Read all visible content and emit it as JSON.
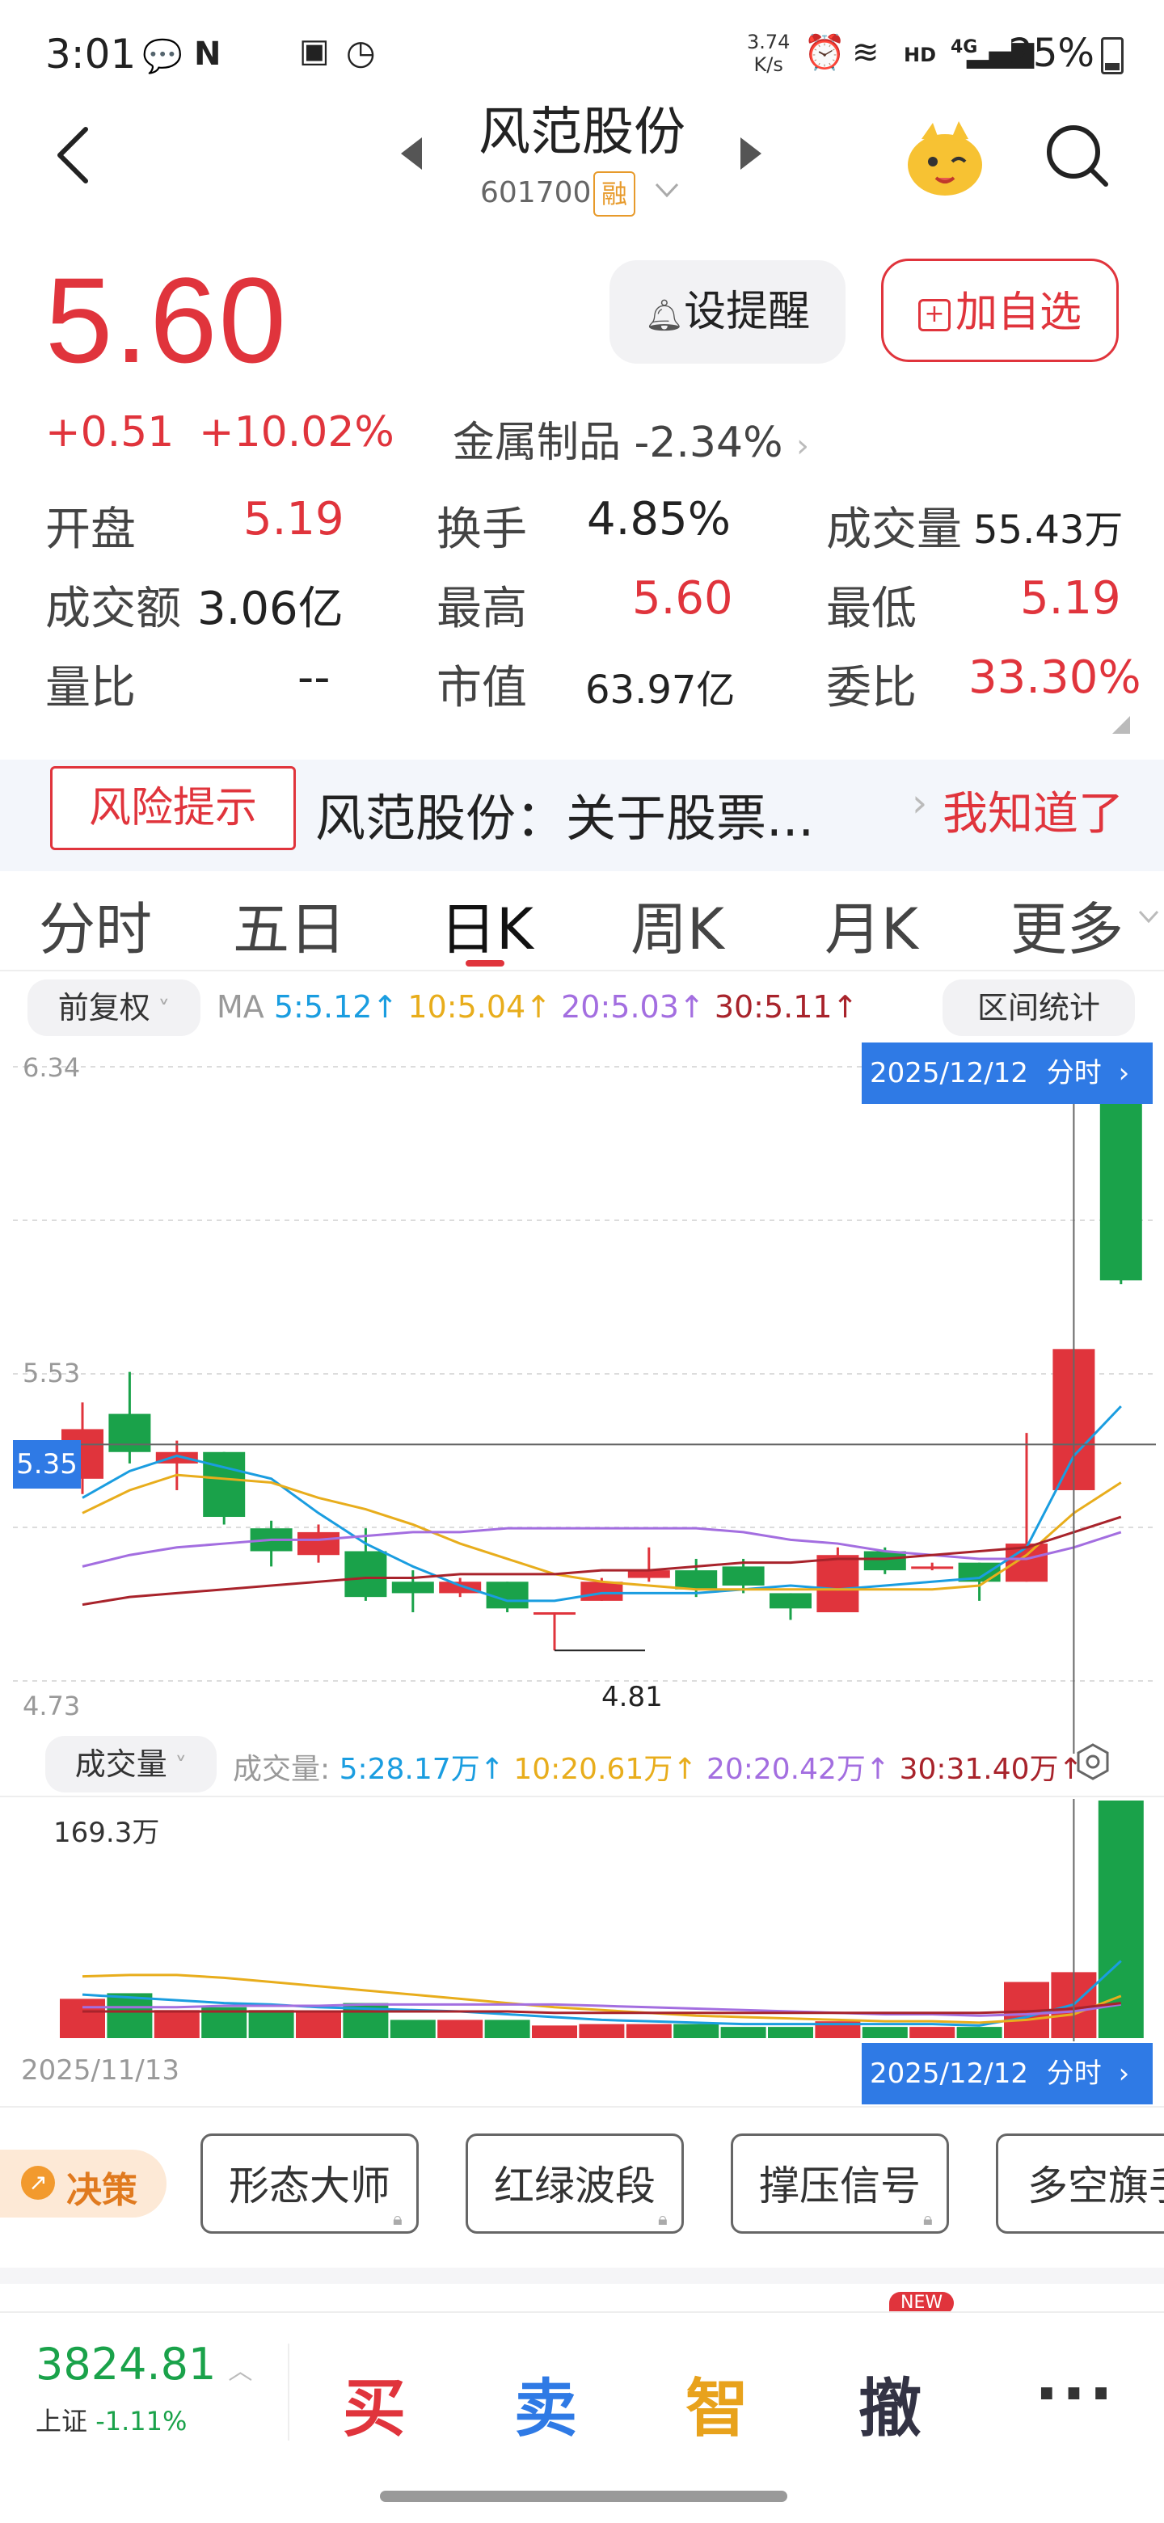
{
  "status": {
    "time": "3:01",
    "speed_top": "3.74",
    "speed_bottom": "K/s",
    "net": "HD",
    "signal": "4G",
    "battery": "25%"
  },
  "header": {
    "title": "风范股份",
    "code": "601700",
    "rong": "融"
  },
  "quote": {
    "price": "5.60",
    "change": "+0.51",
    "change_pct": "+10.02%",
    "sector": "金属制品",
    "sector_pct": "-2.34%",
    "remind_label": "设提醒",
    "add_label": "加自选",
    "stats": [
      {
        "label": "开盘",
        "value": "5.19"
      },
      {
        "label": "换手",
        "value": "4.85%"
      },
      {
        "label": "成交量",
        "value": "55.43万"
      },
      {
        "label": "成交额",
        "value": "3.06亿"
      },
      {
        "label": "最高",
        "value": "5.60"
      },
      {
        "label": "最低",
        "value": "5.19"
      },
      {
        "label": "量比",
        "value": "--"
      },
      {
        "label": "市值",
        "value": "63.97亿"
      },
      {
        "label": "委比",
        "value": "33.30%"
      }
    ]
  },
  "banner": {
    "risk": "风险提示",
    "text": "风范股份：关于股票...",
    "ack": "我知道了"
  },
  "tabs": [
    "分时",
    "五日",
    "日K",
    "周K",
    "月K",
    "更多"
  ],
  "kline_toolbar": {
    "adjust": "前复权",
    "ma_label": "MA",
    "ma5": "5:5.12↑",
    "ma10": "10:5.04↑",
    "ma20": "20:5.03↑",
    "ma30": "30:5.11↑",
    "range_stats": "区间统计",
    "colors": {
      "ma5": "#1a9de0",
      "ma10": "#e8ad1c",
      "ma20": "#a36ee0",
      "ma30": "#a8232b"
    }
  },
  "chart": {
    "y_top": "6.34",
    "y_mid": "5.53",
    "y_bottom": "4.73",
    "crosshair_value": "5.35",
    "crosshair_date": "2025/12/12",
    "fenshi": "分时",
    "low_label": "4.81"
  },
  "volume": {
    "selector": "成交量",
    "prefix": "成交量:",
    "ma5": "5:28.17万↑",
    "ma10": "10:20.61万↑",
    "ma20": "20:20.42万↑",
    "ma30": "30:31.40万↑",
    "max_label": "169.3万",
    "start_date": "2025/11/13",
    "end_date": "2025/12/12",
    "fenshi": "分时"
  },
  "chart_data": {
    "type": "candlestick",
    "ylim": [
      4.73,
      6.34
    ],
    "candles": [
      {
        "o": 5.26,
        "c": 5.39,
        "h": 5.46,
        "l": 5.22,
        "dir": "up"
      },
      {
        "o": 5.43,
        "c": 5.33,
        "h": 5.54,
        "l": 5.3,
        "dir": "down"
      },
      {
        "o": 5.33,
        "c": 5.3,
        "h": 5.36,
        "l": 5.23,
        "dir": "up"
      },
      {
        "o": 5.33,
        "c": 5.16,
        "h": 5.33,
        "l": 5.14,
        "dir": "down"
      },
      {
        "o": 5.13,
        "c": 5.07,
        "h": 5.15,
        "l": 5.03,
        "dir": "down"
      },
      {
        "o": 5.06,
        "c": 5.12,
        "h": 5.14,
        "l": 5.04,
        "dir": "up"
      },
      {
        "o": 5.07,
        "c": 4.95,
        "h": 5.13,
        "l": 4.94,
        "dir": "down"
      },
      {
        "o": 4.96,
        "c": 4.99,
        "h": 5.02,
        "l": 4.91,
        "dir": "down"
      },
      {
        "o": 4.99,
        "c": 4.96,
        "h": 5.0,
        "l": 4.95,
        "dir": "up"
      },
      {
        "o": 4.99,
        "c": 4.92,
        "h": 4.99,
        "l": 4.91,
        "dir": "down"
      },
      {
        "o": 4.91,
        "c": 4.91,
        "h": 4.91,
        "l": 4.81,
        "dir": "up"
      },
      {
        "o": 4.94,
        "c": 4.99,
        "h": 5.0,
        "l": 4.94,
        "dir": "up"
      },
      {
        "o": 5.0,
        "c": 5.02,
        "h": 5.08,
        "l": 4.99,
        "dir": "up"
      },
      {
        "o": 5.02,
        "c": 4.97,
        "h": 5.05,
        "l": 4.95,
        "dir": "down"
      },
      {
        "o": 5.03,
        "c": 4.98,
        "h": 5.05,
        "l": 4.96,
        "dir": "down"
      },
      {
        "o": 4.96,
        "c": 4.92,
        "h": 4.96,
        "l": 4.89,
        "dir": "down"
      },
      {
        "o": 4.91,
        "c": 5.06,
        "h": 5.08,
        "l": 4.91,
        "dir": "up"
      },
      {
        "o": 5.07,
        "c": 5.02,
        "h": 5.08,
        "l": 5.01,
        "dir": "down"
      },
      {
        "o": 5.03,
        "c": 5.03,
        "h": 5.04,
        "l": 5.02,
        "dir": "up"
      },
      {
        "o": 5.04,
        "c": 4.99,
        "h": 5.04,
        "l": 4.94,
        "dir": "down"
      },
      {
        "o": 4.99,
        "c": 5.09,
        "h": 5.38,
        "l": 4.99,
        "dir": "up"
      },
      {
        "o": 5.23,
        "c": 5.6,
        "h": 5.6,
        "l": 5.23,
        "dir": "up"
      },
      {
        "o": 6.3,
        "c": 5.78,
        "h": 6.3,
        "l": 5.77,
        "dir": "down"
      }
    ],
    "ma5": [
      5.21,
      5.28,
      5.32,
      5.29,
      5.26,
      5.17,
      5.09,
      5.03,
      4.98,
      4.94,
      4.94,
      4.96,
      4.96,
      4.96,
      4.97,
      4.98,
      4.97,
      4.98,
      4.99,
      5.0,
      5.08,
      5.32,
      5.45
    ],
    "ma10": [
      5.17,
      5.23,
      5.27,
      5.26,
      5.25,
      5.21,
      5.18,
      5.14,
      5.09,
      5.05,
      5.01,
      4.99,
      4.98,
      4.97,
      4.97,
      4.97,
      4.97,
      4.97,
      4.97,
      4.98,
      5.06,
      5.17,
      5.25
    ],
    "ma20": [
      5.03,
      5.06,
      5.08,
      5.09,
      5.1,
      5.1,
      5.11,
      5.12,
      5.12,
      5.13,
      5.13,
      5.13,
      5.13,
      5.13,
      5.12,
      5.1,
      5.09,
      5.07,
      5.06,
      5.05,
      5.05,
      5.08,
      5.12
    ],
    "ma30": [
      4.93,
      4.95,
      4.96,
      4.97,
      4.98,
      4.99,
      5.0,
      5.0,
      5.01,
      5.01,
      5.01,
      5.02,
      5.02,
      5.03,
      5.04,
      5.04,
      5.05,
      5.05,
      5.06,
      5.07,
      5.08,
      5.12,
      5.16
    ],
    "volume_max": 169.3,
    "volumes": [
      28,
      32,
      20,
      22,
      20,
      19,
      25,
      13,
      13,
      13,
      9,
      10,
      10,
      10,
      8,
      8,
      12,
      8,
      8,
      8,
      40,
      47,
      169.3
    ]
  },
  "decision": {
    "label": "决策",
    "signals": [
      "形态大师",
      "红绿波段",
      "撑压信号",
      "多空旗手"
    ],
    "new_badge": "NEW"
  },
  "bottom": {
    "index_value": "3824.81",
    "index_name": "上证",
    "index_change": "-1.11%",
    "buy": "买",
    "sell": "卖",
    "smart": "智",
    "cancel": "撤",
    "more": "···"
  }
}
